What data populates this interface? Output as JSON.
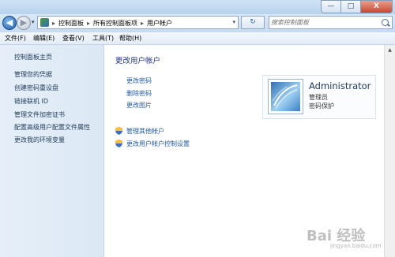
{
  "window": {
    "min_label": "—",
    "max_label": "□",
    "close_label": "X"
  },
  "navigation": {
    "back_symbol": "◀",
    "forward_symbol": "▶",
    "refresh_symbol": "↻",
    "dropdown_symbol": "▾"
  },
  "address": {
    "crumbs": [
      "控制面板",
      "所有控制面板项",
      "用户帐户"
    ],
    "separator": "▸"
  },
  "search": {
    "placeholder": "搜索控制面板"
  },
  "menu": [
    "文件(F)",
    "编辑(E)",
    "查看(V)",
    "工具(T)",
    "帮助(H)"
  ],
  "sidebar": {
    "home": "控制面板主页",
    "links": [
      "管理您的凭据",
      "创建密码重设盘",
      "链接联机 ID",
      "管理文件加密证书",
      "配置高级用户配置文件属性",
      "更改我的环境变量"
    ]
  },
  "main": {
    "title": "更改用户帐户",
    "tasks": [
      "更改密码",
      "删除密码",
      "更改图片"
    ],
    "shield_tasks": [
      "管理其他帐户",
      "更改用户帐户控制设置"
    ]
  },
  "account": {
    "name": "Administrator",
    "role": "管理员",
    "password_status": "密码保护"
  },
  "watermark": {
    "text": "Bai 经验",
    "sub": "jingyan.baidu.com"
  },
  "colors": {
    "link": "#1e5aa8",
    "title": "#1e3287",
    "sidebar_bg": "#e6eff8",
    "chrome": "#c7dbf0"
  },
  "icons": {
    "avatar": "user-picture-icon",
    "shield": "uac-shield-icon",
    "search": "search-icon",
    "address": "control-panel-icon"
  }
}
